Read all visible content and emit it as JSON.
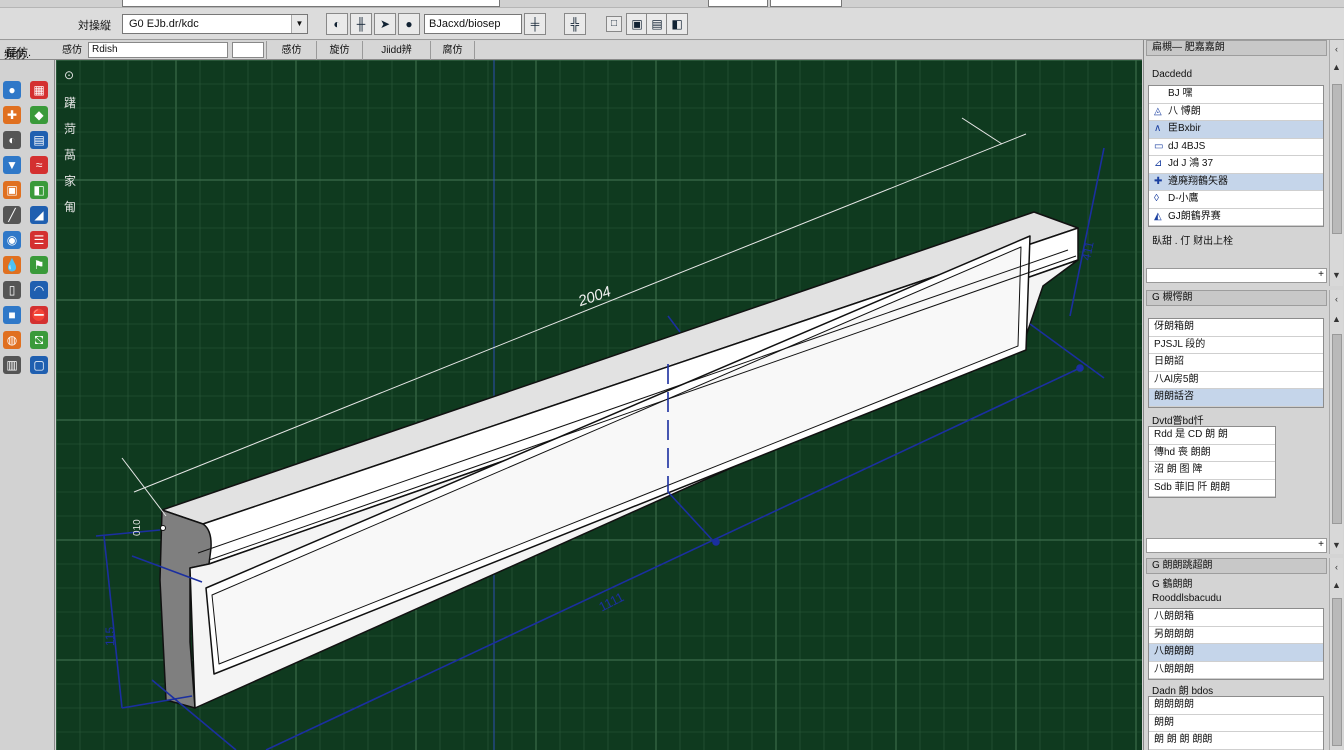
{
  "toolbar": {
    "label": "対操縦",
    "combo_value": "G0 EJb.dr/kdc",
    "field_value": "BJacxd/biosep",
    "buttons": [
      "◐",
      "╫",
      "➤",
      "●",
      "╪",
      "╬",
      "□",
      "▣",
      "▤",
      "◧"
    ]
  },
  "cmdrow": {
    "label": "琵仿.",
    "tab0_label": "感仿",
    "input_value": "Rdish",
    "tabs": [
      "感仿",
      "旋仿",
      "Jiidd辨",
      "腐仿"
    ]
  },
  "palette": {
    "heading": "頻仿.",
    "icons": [
      "tool-sphere-icon",
      "tool-window-icon",
      "tool-cut-icon",
      "tool-plane-icon",
      "tool-mirror-icon",
      "tool-box-icon",
      "tool-move-icon",
      "tool-wave-icon",
      "tool-grid-icon",
      "tool-section-icon",
      "tool-line-icon",
      "tool-wedge-icon",
      "tool-fill-icon",
      "tool-bars-icon",
      "tool-drop-icon",
      "tool-group-icon",
      "tool-door-icon",
      "tool-arch-icon",
      "tool-block-icon",
      "tool-stop-icon",
      "tool-globe-icon",
      "tool-error-icon",
      "tool-books-icon",
      "tool-frame-icon"
    ]
  },
  "viewport": {
    "menu": [
      "⊙",
      "躇",
      "菏",
      "萵",
      "家",
      "匍"
    ],
    "dimensions": {
      "length": "2004",
      "bottom_length": "1111",
      "left_height": "115",
      "right_height": "411",
      "end_small": "010"
    },
    "colors": {
      "background": "#0f3a1f",
      "grid": "#2d5a3d",
      "grid_major": "#3b6b4a",
      "dimension": "#1b2fa0",
      "model_face": "#f2f2f2",
      "model_edge": "#111111"
    }
  },
  "rpanel": {
    "section1": {
      "title": "扁槻— 肥嘉嘉朗",
      "sub": "Dacdedd",
      "items": [
        {
          "icon": "",
          "label": "BJ 嘿"
        },
        {
          "icon": "◬",
          "label": "八 愽朗"
        },
        {
          "icon": "∧",
          "label": "臣Bxbir",
          "selected": true
        },
        {
          "icon": "▭",
          "label": "dJ 4BJS"
        },
        {
          "icon": "⊿",
          "label": "Jd J 鴻 37"
        },
        {
          "icon": "✚",
          "label": "遵廃翔鶴矢器",
          "selected": true
        },
        {
          "icon": "◊",
          "label": "D-小鷹"
        },
        {
          "icon": "◭",
          "label": "GJ朗鶴界赛"
        }
      ],
      "note": "臥甜 . 仃 财出上栓",
      "plus": "+"
    },
    "section2": {
      "title": "G 槻愕朗",
      "items": [
        {
          "label": "伢朗箱朗"
        },
        {
          "label": "PJSJL 段的"
        },
        {
          "label": "日朗詔"
        },
        {
          "label": "八Al房5朗"
        },
        {
          "label": "朗朗話咨",
          "selected": true
        }
      ],
      "sub": "Dvtd嘗bd忏",
      "items2": [
        {
          "label": "Rdd 是 CD 朗 朗"
        },
        {
          "label": "傳hd 喪 朗朗"
        },
        {
          "label": "沼 朗 图 陴"
        },
        {
          "label": "Sdb 菲旧 阡 朗朗"
        }
      ],
      "plus": "+"
    },
    "section3": {
      "title": "G 朗朗跳超朗",
      "sub_a": "G 鶴朗朗",
      "sub_b": "Rooddlsbacudu",
      "items": [
        {
          "label": "八朗朗箱"
        },
        {
          "label": "另朗朗朗"
        },
        {
          "label": "八朗朗朗",
          "selected": true
        },
        {
          "label": "八朗朗朗"
        }
      ],
      "sub_c": "Dadn 朗 bdos",
      "plain_items": [
        "朗朗朗朗",
        "朗朗",
        "朗 朗 朗 朗朗"
      ]
    }
  }
}
